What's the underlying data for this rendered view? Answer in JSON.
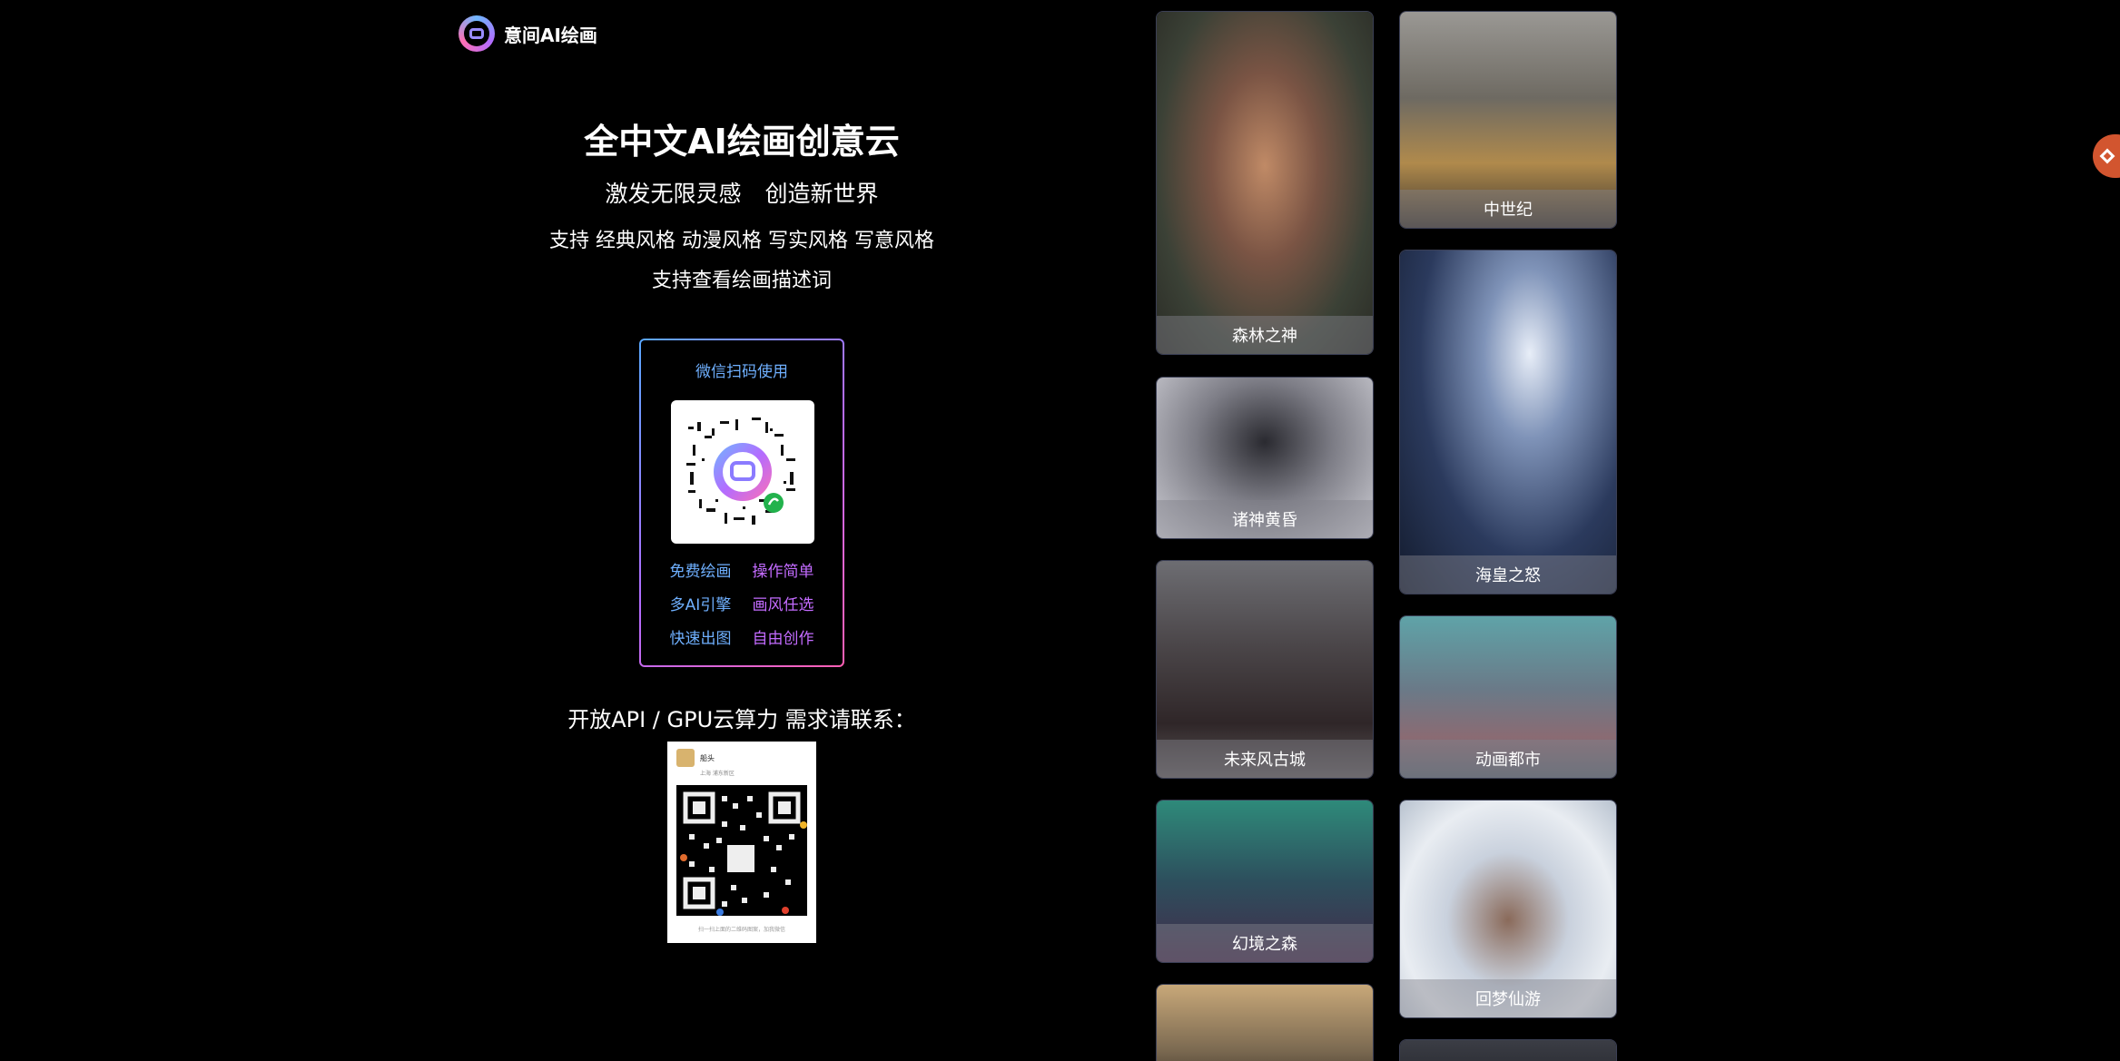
{
  "brand": {
    "name": "意间AI绘画"
  },
  "hero": {
    "title": "全中文AI绘画创意云",
    "slogan_a": "激发无限灵感",
    "slogan_b": "创造新世界",
    "support_styles": "支持 经典风格 动漫风格 写实风格 写意风格",
    "support_prompts": "支持查看绘画描述词"
  },
  "qr_card": {
    "title": "微信扫码使用",
    "features": [
      "免费绘画",
      "操作简单",
      "多AI引擎",
      "画风任选",
      "快速出图",
      "自由创作"
    ]
  },
  "api": {
    "title": "开放API / GPU云算力 需求请联系：",
    "contact_name": "船头",
    "contact_sub": "上海 浦东新区",
    "contact_footer": "扫一扫上面的二维码图案，加我微信"
  },
  "gallery": {
    "left": [
      "森林之神",
      "诸神黄昏",
      "未来风古城",
      "幻境之森",
      ""
    ],
    "right": [
      "中世纪",
      "海皇之怒",
      "动画都市",
      "回梦仙游",
      ""
    ]
  },
  "colors": {
    "accent_blue": "#6fb0ff",
    "accent_purple": "#c36bff",
    "side_button": "#d2552f"
  }
}
